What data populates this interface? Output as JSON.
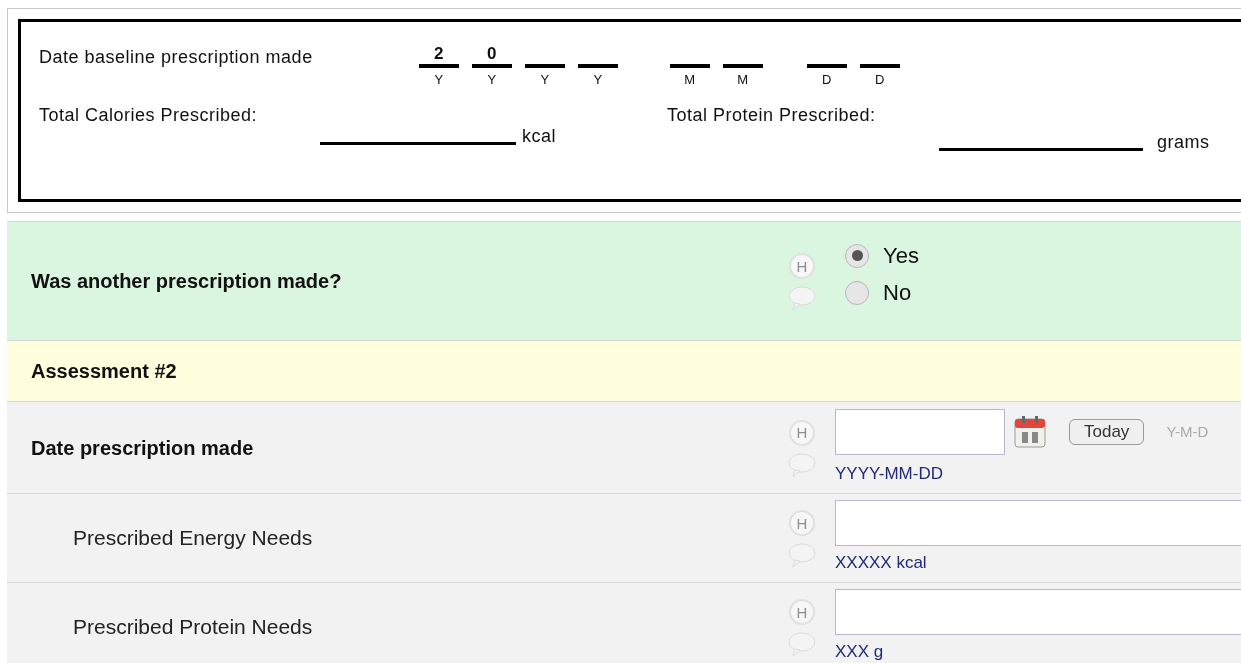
{
  "paper_form": {
    "date_label": "Date baseline prescription made",
    "date_groups": [
      [
        {
          "value": "2",
          "label": "Y"
        },
        {
          "value": "0",
          "label": "Y"
        },
        {
          "label": "Y"
        },
        {
          "label": "Y"
        }
      ],
      [
        {
          "label": "M"
        },
        {
          "label": "M"
        }
      ],
      [
        {
          "label": "D"
        },
        {
          "label": "D"
        }
      ]
    ],
    "calories_label": "Total Calories Prescribed:",
    "calories_unit": "kcal",
    "protein_label": "Total Protein Prescribed:",
    "protein_unit": "grams"
  },
  "rows": [
    {
      "kind": "radio",
      "label": "Was another prescription made?",
      "help": "H",
      "options": [
        {
          "label": "Yes",
          "selected": true
        },
        {
          "label": "No",
          "selected": false
        }
      ]
    },
    {
      "kind": "section",
      "label": "Assessment #2"
    },
    {
      "kind": "date",
      "label": "Date prescription made",
      "help": "H",
      "button": "Today",
      "format": "Y-M-D",
      "hint": "YYYY-MM-DD"
    },
    {
      "kind": "text",
      "label": "Prescribed Energy Needs",
      "help": "H",
      "hint": "XXXXX kcal"
    },
    {
      "kind": "text",
      "label": "Prescribed Protein Needs",
      "help": "H",
      "hint": "XXX g"
    }
  ]
}
